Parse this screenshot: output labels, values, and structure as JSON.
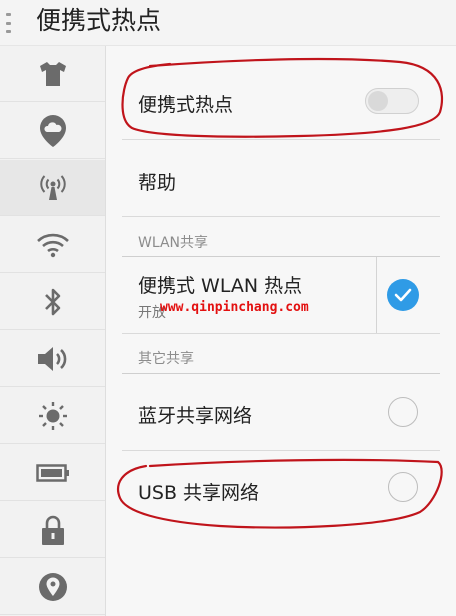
{
  "header": {
    "title": "便携式热点",
    "menu_icon": "vertical-dots-icon"
  },
  "sidebar": {
    "items": [
      {
        "icon": "shirt-icon"
      },
      {
        "icon": "cloud-icon"
      },
      {
        "icon": "hotspot-antenna-icon",
        "selected": true
      },
      {
        "icon": "wifi-icon"
      },
      {
        "icon": "bluetooth-icon"
      },
      {
        "icon": "volume-icon"
      },
      {
        "icon": "brightness-icon"
      },
      {
        "icon": "battery-icon"
      },
      {
        "icon": "lock-icon"
      },
      {
        "icon": "location-icon"
      }
    ]
  },
  "main": {
    "hotspot_toggle": {
      "label": "便携式热点",
      "state": "off"
    },
    "help": {
      "label": "帮助"
    },
    "wlan_section": {
      "header": "WLAN共享"
    },
    "wlan_hotspot": {
      "label": "便携式 WLAN 热点",
      "status": "开放",
      "checked": true
    },
    "other_section": {
      "header": "其它共享"
    },
    "bluetooth_share": {
      "label": "蓝牙共享网络",
      "checked": false
    },
    "usb_share": {
      "label": "USB 共享网络",
      "checked": false
    }
  },
  "watermark": {
    "text": "www.qinpinchang.com"
  },
  "colors": {
    "accent": "#2f9be6",
    "annotation": "#c0141b",
    "watermark": "#e31010"
  }
}
